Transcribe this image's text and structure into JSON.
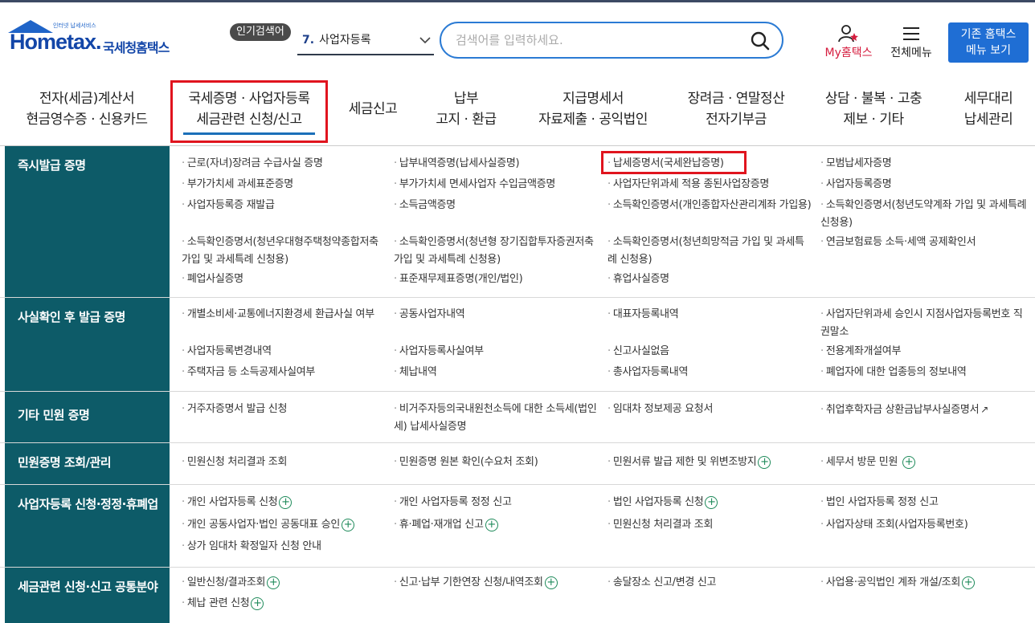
{
  "brand": {
    "sub": "인터넷 납세서비스",
    "name": "Hometax.",
    "ko_name": "국세청홈택스",
    "color": "#1346a8"
  },
  "popular": {
    "badge": "인기검색어",
    "rank": "7.",
    "term": "사업자등록"
  },
  "search": {
    "placeholder": "검색어를 입력하세요."
  },
  "actions": {
    "my_label": "My홈택스",
    "all_label": "전체메뉴",
    "old_line1": "기존 홈택스",
    "old_line2": "메뉴 보기"
  },
  "nav": [
    {
      "l1": "전자(세금)계산서",
      "l2": "현금영수증 · 신용카드"
    },
    {
      "l1": "국세증명 · 사업자등록",
      "l2": "세금관련 신청/신고"
    },
    {
      "l1": "세금신고",
      "l2": ""
    },
    {
      "l1": "납부",
      "l2": "고지 · 환급"
    },
    {
      "l1": "지급명세서",
      "l2": "자료제출 · 공익법인"
    },
    {
      "l1": "장려금 · 연말정산",
      "l2": "전자기부금"
    },
    {
      "l1": "상담 · 불복 · 고충",
      "l2": "제보 · 기타"
    },
    {
      "l1": "세무대리",
      "l2": "납세관리"
    }
  ],
  "sections": [
    {
      "title": "즉시발급 증명",
      "items": [
        "근로(자녀)장려금 수급사실 증명",
        "납부내역증명(납세사실증명)",
        "납세증명서(국세완납증명)",
        "모범납세자증명",
        "부가가치세 과세표준증명",
        "부가가치세 면세사업자 수입금액증명",
        "사업자단위과세 적용 종된사업장증명",
        "사업자등록증명",
        "사업자등록증 재발급",
        "소득금액증명",
        "소득확인증명서(개인종합자산관리계좌 가입용)",
        "소득확인증명서(청년도약계좌 가입 및 과세특례 신청용)",
        "소득확인증명서(청년우대형주택청약종합저축 가입 및 과세특례 신청용)",
        "소득확인증명서(청년형 장기집합투자증권저축 가입 및 과세특례 신청용)",
        "소득확인증명서(청년희망적금 가입 및 과세특례 신청용)",
        "연금보험료등 소득·세액 공제확인서",
        "폐업사실증명",
        "표준재무제표증명(개인/법인)",
        "휴업사실증명"
      ]
    },
    {
      "title": "사실확인 후 발급 증명",
      "items": [
        "개별소비세·교통에너지환경세 환급사실 여부",
        "공동사업자내역",
        "대표자등록내역",
        "사업자단위과세 승인시 지점사업자등록번호 직권말소",
        "사업자등록변경내역",
        "사업자등록사실여부",
        "신고사실없음",
        "전용계좌개설여부",
        "주택자금 등 소득공제사실여부",
        "체납내역",
        "총사업자등록내역",
        "폐업자에 대한 업종등의 정보내역"
      ]
    },
    {
      "title": "기타 민원 증명",
      "items": [
        "거주자증명서 발급 신청",
        "비거주자등의국내원천소득에 대한 소득세(법인세) 납세사실증명",
        "임대차 정보제공 요청서",
        "취업후학자금 상환금납부사실증명서"
      ]
    },
    {
      "title": "민원증명 조회/관리",
      "items": [
        "민원신청 처리결과 조회",
        "민원증명 원본 확인(수요처 조회)",
        "민원서류 발급 제한 및 위변조방지",
        "세무서 방문 민원"
      ]
    },
    {
      "title": "사업자등록 신청·정정·휴폐업",
      "items": [
        "개인 사업자등록 신청",
        "개인 사업자등록 정정 신고",
        "법인 사업자등록 신청",
        "법인 사업자등록 정정 신고",
        "개인 공동사업자·법인 공동대표 승인",
        "휴·폐업·재개업 신고",
        "민원신청 처리결과 조회",
        "사업자상태 조회(사업자등록번호)",
        "상가 임대차 확정일자 신청 안내"
      ]
    },
    {
      "title": "세금관련 신청·신고 공통분야",
      "items": [
        "일반신청/결과조회",
        "신고·납부 기한연장 신청/내역조회",
        "송달장소 신고/변경 신고",
        "사업용·공익법인 계좌 개설/조회",
        "체납 관련 신청"
      ]
    }
  ],
  "colors": {
    "section_bg": "#0d5b68",
    "highlight": "#e0141e",
    "accent": "#1f6ed4"
  }
}
